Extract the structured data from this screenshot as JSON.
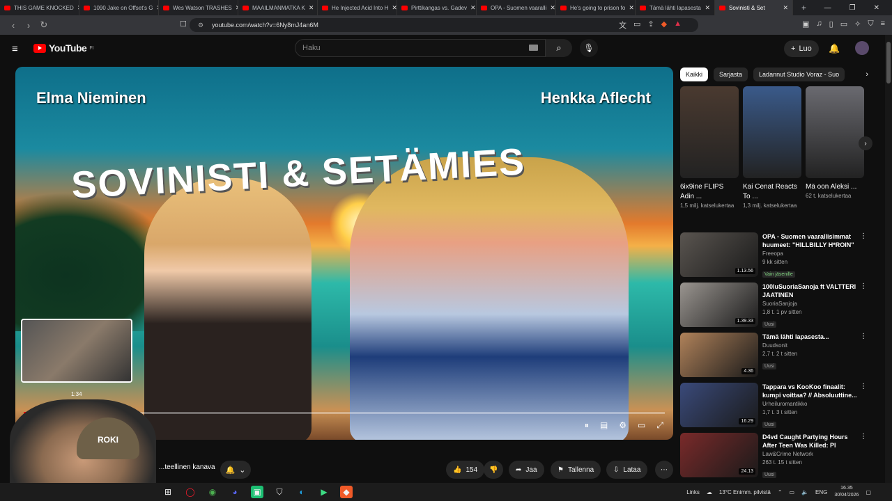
{
  "browser": {
    "tabs": [
      {
        "label": "THIS GAME KNOCKED"
      },
      {
        "label": "1090 Jake on Offset's G"
      },
      {
        "label": "Wes Watson TRASHES"
      },
      {
        "label": "MAAILMANMATKA K"
      },
      {
        "label": "He Injected Acid Into H"
      },
      {
        "label": "Pirttikangas vs. Gadev"
      },
      {
        "label": "OPA - Suomen vaaralli"
      },
      {
        "label": "He's going to prison fo"
      },
      {
        "label": "Tämä lähti lapasesta"
      },
      {
        "label": "Sovinisti & Set"
      }
    ],
    "url": "youtube.com/watch?v=6Ny8mJ4an6M"
  },
  "header": {
    "logo_word": "YouTube",
    "logo_region": "FI",
    "search_placeholder": "Haku",
    "create_label": "Luo"
  },
  "player": {
    "title_art": "SOVINISTI & SETÄMIES",
    "name_left": "Elma Nieminen",
    "name_right": "Henkka Aflecht",
    "hover_time": "1:34",
    "progress_fraction": 0.03
  },
  "below": {
    "channel_label": "...teellinen kanava",
    "cap_text": "ROKI",
    "like_count": "154",
    "share_label": "Jaa",
    "save_label": "Tallenna",
    "download_label": "Lataa"
  },
  "sidebar": {
    "chips": [
      {
        "label": "Kaikki"
      },
      {
        "label": "Sarjasta"
      },
      {
        "label": "Ladannut Studio Voraz - Suo"
      }
    ],
    "shorts": [
      {
        "title": "6ix9ine FLIPS Adin ...",
        "views": "1,5 milj. katselukertaa",
        "color": "#4a3a30"
      },
      {
        "title": "Kai Cenat Reacts To ...",
        "views": "1,3 milj. katselukertaa",
        "color": "#3a5a8a"
      },
      {
        "title": "Mä oon Aleksi ...",
        "views": "62 t. katselukertaa",
        "color": "#6a6a70"
      }
    ],
    "videos": [
      {
        "title": "OPA - Suomen vaarallisimmat huumeet: \"HILLBILLY H*ROIN\"",
        "channel": "Freeopa",
        "meta": "9 kk sitten",
        "badge": "Vain jäsenille",
        "duration": "1.13.56",
        "color": "#5a5550"
      },
      {
        "title": "100luSuoriaSanoja ft VALTTERI JAATINEN",
        "channel": "SuoriaSanjoja",
        "meta": "1,8 t.  1 pv sitten",
        "badge": "Uusi",
        "duration": "1.39.33",
        "color": "#9a9590"
      },
      {
        "title": "Tämä lähti lapasesta...",
        "channel": "Duudsonit",
        "meta": "2,7 t.  2 t sitten",
        "badge": "Uusi",
        "duration": "4.36",
        "color": "#b0825a"
      },
      {
        "title": "Tappara vs KooKoo finaalit: kumpi voittaa? // Absoluuttine...",
        "channel": "Urheiluromantikko",
        "meta": "1,7 t.  3 t sitten",
        "badge": "Uusi",
        "duration": "16.29",
        "color": "#3a4a7a"
      },
      {
        "title": "D4vd Caught Partying Hours After Teen Was Killed: Pl",
        "channel": "Law&Crime Network",
        "meta": "263 t.  15 t sitten",
        "badge": "Uusi",
        "duration": "24.13",
        "color": "#7a2a2a"
      }
    ]
  },
  "taskbar": {
    "links_label": "Links",
    "weather": "13°C  Enimm. pilvistä",
    "lang": "ENG",
    "time": "16.35",
    "date": "30/04/2026"
  }
}
